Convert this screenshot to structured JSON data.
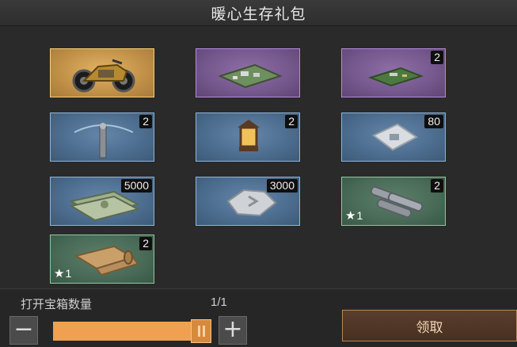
{
  "header": {
    "title": "暖心生存礼包"
  },
  "rewards": [
    {
      "name": "motorcycle",
      "rarity": "gold",
      "icon": "motorcycle-icon",
      "count": "",
      "stars": ""
    },
    {
      "name": "base-map",
      "rarity": "purple",
      "icon": "base-map-icon",
      "count": "",
      "stars": ""
    },
    {
      "name": "circuit-board",
      "rarity": "purple",
      "icon": "circuit-board-icon",
      "count": "2",
      "stars": ""
    },
    {
      "name": "sprinkler",
      "rarity": "blue",
      "icon": "sprinkler-icon",
      "count": "2",
      "stars": ""
    },
    {
      "name": "lantern",
      "rarity": "blue",
      "icon": "lantern-icon",
      "count": "2",
      "stars": ""
    },
    {
      "name": "seed-packet",
      "rarity": "blue",
      "icon": "seed-packet-icon",
      "count": "80",
      "stars": ""
    },
    {
      "name": "cash-bundle",
      "rarity": "blue",
      "icon": "cash-bundle-icon",
      "count": "5000",
      "stars": ""
    },
    {
      "name": "silver-ore",
      "rarity": "blue",
      "icon": "silver-ore-icon",
      "count": "3000",
      "stars": ""
    },
    {
      "name": "pipes",
      "rarity": "green",
      "icon": "pipes-icon",
      "count": "2",
      "stars": "1"
    },
    {
      "name": "blueprint-scroll",
      "rarity": "green",
      "icon": "scroll-icon",
      "count": "2",
      "stars": "1"
    }
  ],
  "footer": {
    "quantity_label": "打开宝箱数量",
    "quantity_value": "1/1",
    "slider_fraction": 1.0,
    "minus_label": "−",
    "plus_label": "+",
    "claim_label": "领取"
  },
  "colors": {
    "accent_orange": "#f0a050",
    "gold": "#c3934a",
    "purple": "#74578c",
    "blue": "#4c6c8e",
    "green": "#486a56"
  }
}
